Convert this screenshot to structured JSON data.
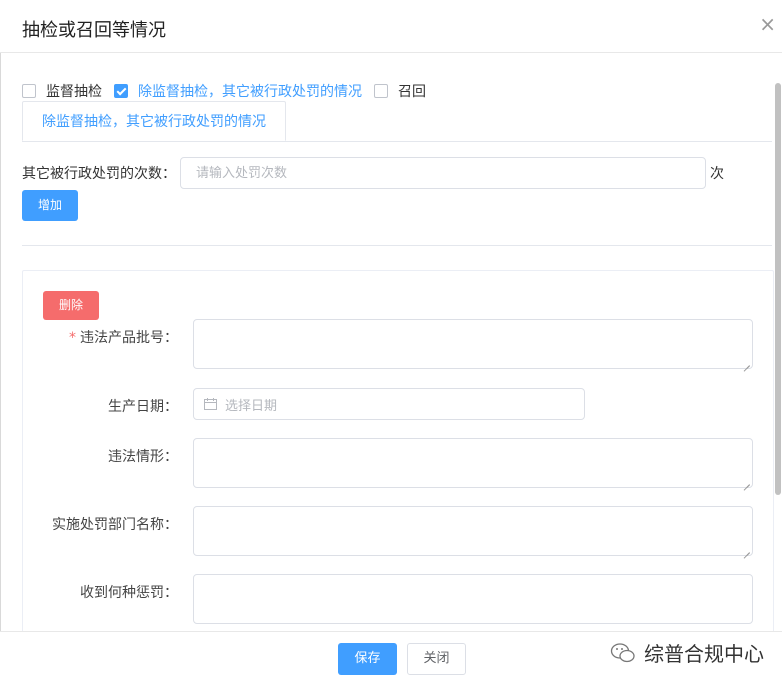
{
  "dialog": {
    "title": "抽检或召回等情况"
  },
  "checkboxes": [
    {
      "label": "监督抽检",
      "checked": false
    },
    {
      "label": "除监督抽检，其它被行政处罚的情况",
      "checked": true
    },
    {
      "label": "召回",
      "checked": false
    }
  ],
  "tab": {
    "label": "除监督抽检，其它被行政处罚的情况"
  },
  "count": {
    "label": "其它被行政处罚的次数：",
    "placeholder": "请输入处罚次数",
    "unit": "次",
    "add_button": "增加"
  },
  "record": {
    "delete_button": "删除",
    "fields": {
      "batch_no": {
        "label": "违法产品批号：",
        "required_mark": "*"
      },
      "production_date": {
        "label": "生产日期：",
        "placeholder": "选择日期"
      },
      "violation": {
        "label": "违法情形："
      },
      "department": {
        "label": "实施处罚部门名称："
      },
      "penalty": {
        "label": "收到何种惩罚："
      }
    }
  },
  "footer": {
    "save_button": "保存",
    "close_button": "关闭"
  },
  "watermark": {
    "text": "综普合规中心"
  },
  "colors": {
    "primary": "#409eff",
    "danger": "#f56c6c",
    "border": "#dcdfe6"
  }
}
